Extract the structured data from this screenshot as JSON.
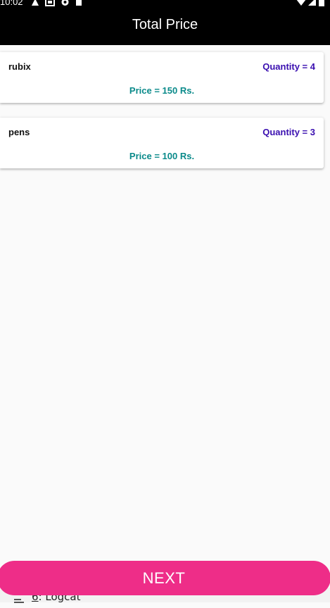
{
  "status_bar": {
    "time": "10:02",
    "left_icons": [
      "warning-icon",
      "image-icon",
      "sync-icon",
      "sd-card-icon"
    ],
    "right_icons": [
      "wifi-icon",
      "signal-icon",
      "battery-icon"
    ]
  },
  "app_bar": {
    "title": "Total Price"
  },
  "items": [
    {
      "name": "rubix",
      "quantity": "Quantity = 4",
      "price": "Price = 150 Rs."
    },
    {
      "name": "pens",
      "quantity": "Quantity = 3",
      "price": "Price = 100 Rs."
    }
  ],
  "next_button": {
    "label": "NEXT"
  },
  "logcat": {
    "shortcut": "6",
    "label": ": Logcat"
  },
  "colors": {
    "app_bar": "#000000",
    "quantity_text": "#3a0fb0",
    "price_text": "#0a8a8a",
    "next_button": "#ee2d88",
    "background": "#fafafa"
  }
}
